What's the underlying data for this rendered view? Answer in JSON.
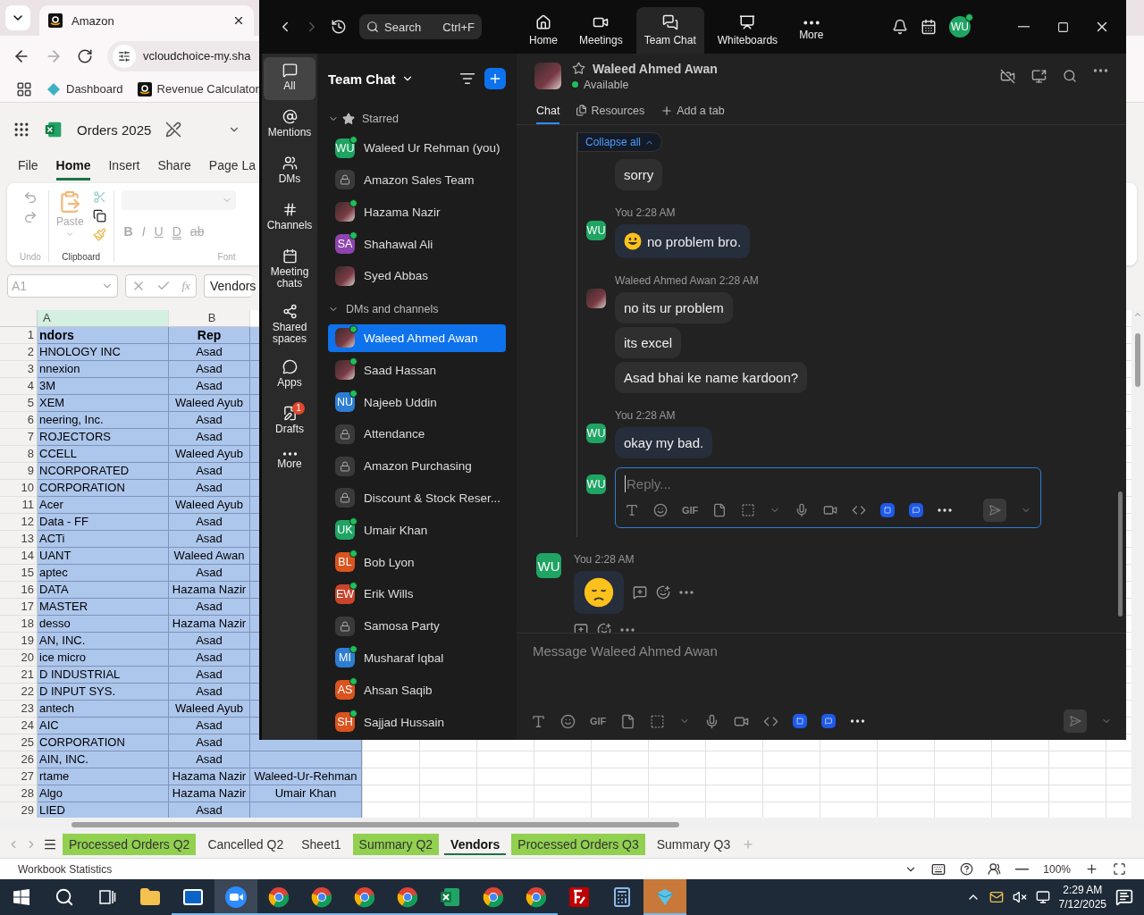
{
  "browser": {
    "tab": {
      "title": "Amazon"
    },
    "url": "vcloudchoice-my.sha",
    "bookmarks": [
      {
        "label": "Dashboard",
        "kind": "diamond"
      },
      {
        "label": "Revenue Calculator",
        "kind": "amazon"
      }
    ]
  },
  "excel": {
    "title": "Orders 2025",
    "ribbon_tabs": [
      {
        "label": "File",
        "selected": false
      },
      {
        "label": "Home",
        "selected": true
      },
      {
        "label": "Insert",
        "selected": false
      },
      {
        "label": "Share",
        "selected": false
      },
      {
        "label": "Page La",
        "selected": false
      }
    ],
    "ribbon": {
      "undo_label": "Undo",
      "paste_label": "Paste",
      "clipboard_label": "Clipboard",
      "font_label": "Font",
      "font_buttons": [
        "B",
        "I",
        "U",
        "D",
        "ab"
      ]
    },
    "name_box": "A1",
    "function_label": "fx",
    "formula": "Vendors",
    "columns": [
      "A",
      "B"
    ],
    "rows": [
      {
        "number": "1",
        "kind": "header",
        "selected": true,
        "a": "ndors",
        "b": "Rep"
      },
      {
        "number": "2",
        "kind": "data",
        "selected": true,
        "a": "HNOLOGY INC",
        "b": "Asad"
      },
      {
        "number": "3",
        "kind": "data",
        "selected": true,
        "a": "nnexion",
        "b": "Asad"
      },
      {
        "number": "4",
        "kind": "data",
        "selected": true,
        "a": "3M",
        "b": "Asad"
      },
      {
        "number": "5",
        "kind": "data",
        "selected": true,
        "a": "XEM",
        "b": "Waleed Ayub"
      },
      {
        "number": "6",
        "kind": "data",
        "selected": true,
        "a": "neering, Inc.",
        "b": "Asad"
      },
      {
        "number": "7",
        "kind": "data",
        "selected": true,
        "a": "ROJECTORS",
        "b": "Asad"
      },
      {
        "number": "8",
        "kind": "data",
        "selected": true,
        "a": "CCELL",
        "b": "Waleed Ayub"
      },
      {
        "number": "9",
        "kind": "data",
        "selected": true,
        "a": "NCORPORATED",
        "b": "Asad"
      },
      {
        "number": "10",
        "kind": "data",
        "selected": true,
        "a": "CORPORATION",
        "b": "Asad"
      },
      {
        "number": "11",
        "kind": "data",
        "selected": true,
        "a": "Acer",
        "b": "Waleed Ayub"
      },
      {
        "number": "12",
        "kind": "data",
        "selected": true,
        "a": "Data - FF",
        "b": "Asad"
      },
      {
        "number": "13",
        "kind": "data",
        "selected": true,
        "a": "ACTi",
        "b": "Asad"
      },
      {
        "number": "14",
        "kind": "data",
        "selected": true,
        "a": "UANT",
        "b": "Waleed Awan"
      },
      {
        "number": "15",
        "kind": "data",
        "selected": true,
        "a": "aptec",
        "b": "Asad"
      },
      {
        "number": "16",
        "kind": "data",
        "selected": true,
        "a": "DATA",
        "b": "Hazama Nazir"
      },
      {
        "number": "17",
        "kind": "data",
        "selected": true,
        "a": "MASTER",
        "b": "Asad"
      },
      {
        "number": "18",
        "kind": "data",
        "selected": true,
        "a": "desso",
        "b": "Hazama Nazir"
      },
      {
        "number": "19",
        "kind": "data",
        "selected": true,
        "a": "AN, INC.",
        "b": "Asad"
      },
      {
        "number": "20",
        "kind": "data",
        "selected": true,
        "a": "ice micro",
        "b": "Asad"
      },
      {
        "number": "21",
        "kind": "data",
        "selected": true,
        "a": "D INDUSTRIAL",
        "b": "Asad"
      },
      {
        "number": "22",
        "kind": "data",
        "selected": true,
        "a": "D INPUT SYS.",
        "b": "Asad"
      },
      {
        "number": "23",
        "kind": "data",
        "selected": true,
        "a": "antech",
        "b": "Waleed Ayub"
      },
      {
        "number": "24",
        "kind": "data",
        "selected": true,
        "a": "AIC",
        "b": "Asad"
      },
      {
        "number": "25",
        "kind": "data",
        "selected": true,
        "a": "CORPORATION",
        "b": "Asad"
      },
      {
        "number": "26",
        "kind": "data",
        "selected": true,
        "a": "AIN, INC.",
        "b": "Asad"
      },
      {
        "number": "27",
        "kind": "data",
        "selected": true,
        "a": "rtame",
        "b": "Hazama Nazir",
        "c": "Waleed-Ur-Rehman"
      },
      {
        "number": "28",
        "kind": "data",
        "selected": true,
        "a": "Algo",
        "b": "Hazama Nazir",
        "c": "Umair Khan"
      },
      {
        "number": "29",
        "kind": "data",
        "selected": true,
        "a": "LIED",
        "b": "Asad"
      }
    ],
    "sheet_tabs": [
      {
        "label": "Processed Orders Q2",
        "selected": false,
        "color": "#92d050"
      },
      {
        "label": "Cancelled Q2",
        "selected": false
      },
      {
        "label": "Sheet1",
        "selected": false
      },
      {
        "label": "Summary Q2",
        "selected": false,
        "color": "#92d050"
      },
      {
        "label": "Vendors",
        "selected": true
      },
      {
        "label": "Processed Orders Q3",
        "selected": false,
        "color": "#92d050"
      },
      {
        "label": "Summary Q3",
        "selected": false
      }
    ],
    "status": "Workbook Statistics",
    "zoom": "100%"
  },
  "zoom_app": {
    "search": {
      "placeholder": "Search",
      "shortcut": "Ctrl+F"
    },
    "nav": [
      {
        "label": "Home",
        "kind": "home",
        "selected": false
      },
      {
        "label": "Meetings",
        "kind": "video",
        "selected": false
      },
      {
        "label": "Team Chat",
        "kind": "chat",
        "selected": true
      },
      {
        "label": "Whiteboards",
        "kind": "board",
        "selected": false
      },
      {
        "label": "More",
        "kind": "more",
        "selected": false
      }
    ],
    "me": {
      "initials": "WU",
      "color": "#1fa463"
    },
    "rail": [
      {
        "label": "All",
        "kind": "chat",
        "selected": true
      },
      {
        "label": "Mentions",
        "kind": "mention",
        "selected": false
      },
      {
        "label": "DMs",
        "kind": "people",
        "selected": false
      },
      {
        "label": "Channels",
        "kind": "hash",
        "selected": false
      },
      {
        "label": "Meeting chats",
        "kind": "calendar",
        "selected": false
      },
      {
        "label": "Shared spaces",
        "kind": "share",
        "selected": false
      },
      {
        "label": "Apps",
        "kind": "bubble",
        "selected": false
      },
      {
        "label": "Drafts",
        "kind": "draft",
        "selected": false,
        "badge": "1"
      },
      {
        "label": "More",
        "kind": "more",
        "selected": false
      }
    ],
    "chat_list": {
      "title": "Team Chat",
      "sections": [
        {
          "title": "Starred",
          "kind": "starred",
          "items": [
            {
              "name": "Waleed Ur Rehman (you)",
              "avatar": {
                "kind": "initials",
                "initials": "WU",
                "color": "#1fa463"
              },
              "online": true,
              "selected": false
            },
            {
              "name": "Amazon Sales Team",
              "avatar": {
                "kind": "lock"
              },
              "online": false,
              "selected": false
            },
            {
              "name": "Hazama Nazir",
              "avatar": {
                "kind": "photo"
              },
              "online": true,
              "selected": false
            },
            {
              "name": "Shahawal Ali",
              "avatar": {
                "kind": "initials",
                "initials": "SA",
                "color": "#8e44ad"
              },
              "online": true,
              "selected": false
            },
            {
              "name": "Syed Abbas",
              "avatar": {
                "kind": "photo"
              },
              "online": false,
              "selected": false
            }
          ]
        },
        {
          "title": "DMs and channels",
          "kind": "plain",
          "items": [
            {
              "name": "Waleed Ahmed Awan",
              "avatar": {
                "kind": "photo"
              },
              "online": true,
              "selected": true
            },
            {
              "name": "Saad Hassan",
              "avatar": {
                "kind": "photo"
              },
              "online": true,
              "selected": false
            },
            {
              "name": "Najeeb Uddin",
              "avatar": {
                "kind": "initials",
                "initials": "NU",
                "color": "#2d7dd2"
              },
              "online": true,
              "selected": false
            },
            {
              "name": "Attendance",
              "avatar": {
                "kind": "lock"
              },
              "online": false,
              "selected": false
            },
            {
              "name": "Amazon Purchasing",
              "avatar": {
                "kind": "lock"
              },
              "online": false,
              "selected": false
            },
            {
              "name": "Discount & Stock Reser...",
              "avatar": {
                "kind": "lock"
              },
              "online": false,
              "selected": false
            },
            {
              "name": "Umair Khan",
              "avatar": {
                "kind": "initials",
                "initials": "UK",
                "color": "#1fa463"
              },
              "online": true,
              "selected": false
            },
            {
              "name": "Bob Lyon",
              "avatar": {
                "kind": "initials",
                "initials": "BL",
                "color": "#d9541e"
              },
              "online": true,
              "selected": false
            },
            {
              "name": "Erik Wills",
              "avatar": {
                "kind": "initials",
                "initials": "EW",
                "color": "#c8452c"
              },
              "online": true,
              "selected": false
            },
            {
              "name": "Samosa Party",
              "avatar": {
                "kind": "lock"
              },
              "online": false,
              "selected": false
            },
            {
              "name": "Musharaf Iqbal",
              "avatar": {
                "kind": "initials",
                "initials": "MI",
                "color": "#2d7dd2"
              },
              "online": true,
              "selected": false
            },
            {
              "name": "Ahsan Saqib",
              "avatar": {
                "kind": "initials",
                "initials": "AS",
                "color": "#d9541e"
              },
              "online": true,
              "selected": false
            },
            {
              "name": "Sajjad Hussain",
              "avatar": {
                "kind": "initials",
                "initials": "SH",
                "color": "#d9541e"
              },
              "online": true,
              "selected": false
            }
          ]
        }
      ]
    },
    "conversation": {
      "name": "Waleed Ahmed Awan",
      "status": "Available",
      "tabs": [
        {
          "label": "Chat",
          "kind": "chat",
          "selected": true
        },
        {
          "label": "Resources",
          "kind": "files",
          "selected": false
        },
        {
          "label": "Add a tab",
          "kind": "add",
          "selected": false
        }
      ],
      "thread": {
        "collapse_label": "Collapse all",
        "groups": [
          {
            "kind": "continuation",
            "mine": false,
            "bubbles": [
              {
                "kind": "text",
                "text": "sorry"
              }
            ]
          },
          {
            "kind": "message",
            "mine": true,
            "avatar": {
              "kind": "initials",
              "initials": "WU",
              "color": "#1fa463"
            },
            "header": "You 2:28 AM",
            "bubbles": [
              {
                "kind": "smile-text",
                "text": "no problem bro."
              }
            ]
          },
          {
            "kind": "message",
            "mine": false,
            "avatar": {
              "kind": "photo"
            },
            "header": "Waleed Ahmed Awan 2:28 AM",
            "bubbles": [
              {
                "kind": "text",
                "text": "no its ur problem"
              },
              {
                "kind": "text",
                "text": "its excel"
              },
              {
                "kind": "text",
                "text": "Asad bhai ke name kardoon?"
              }
            ]
          },
          {
            "kind": "message",
            "mine": true,
            "avatar": {
              "kind": "initials",
              "initials": "WU",
              "color": "#1fa463"
            },
            "header": "You 2:28 AM",
            "bubbles": [
              {
                "kind": "text",
                "text": "okay my bad."
              }
            ]
          }
        ],
        "reply": {
          "avatar": {
            "kind": "initials",
            "initials": "WU",
            "color": "#1fa463"
          },
          "placeholder": "Reply...",
          "gif_label": "GIF"
        }
      },
      "last_message": {
        "avatar": {
          "kind": "initials",
          "initials": "WU",
          "color": "#1fa463"
        },
        "header": "You 2:28 AM",
        "bubbles": [
          {
            "kind": "frown"
          }
        ]
      },
      "compose": {
        "placeholder": "Message Waleed Ahmed Awan",
        "gif_label": "GIF"
      }
    }
  },
  "taskbar": {
    "apps": [
      {
        "kind": "start",
        "running": false,
        "selected": false,
        "attention": false
      },
      {
        "kind": "search",
        "running": false,
        "selected": false,
        "attention": false
      },
      {
        "kind": "taskview",
        "running": false,
        "selected": false,
        "attention": false
      },
      {
        "kind": "folder",
        "running": false,
        "selected": false,
        "attention": false
      },
      {
        "kind": "outlook",
        "running": true,
        "selected": false,
        "attention": false
      },
      {
        "kind": "zoom",
        "running": true,
        "selected": true,
        "attention": false
      },
      {
        "kind": "chrome",
        "running": true,
        "selected": false,
        "attention": false
      },
      {
        "kind": "chrome",
        "running": true,
        "selected": false,
        "attention": false
      },
      {
        "kind": "chrome",
        "running": true,
        "selected": false,
        "attention": false
      },
      {
        "kind": "chrome",
        "running": true,
        "selected": false,
        "attention": false
      },
      {
        "kind": "excel",
        "running": true,
        "selected": false,
        "attention": false
      },
      {
        "kind": "chrome",
        "running": true,
        "selected": false,
        "attention": false
      },
      {
        "kind": "chrome",
        "running": true,
        "selected": false,
        "attention": false
      },
      {
        "kind": "filezilla",
        "running": false,
        "selected": false,
        "attention": false
      },
      {
        "kind": "calculator",
        "running": false,
        "selected": false,
        "attention": false
      },
      {
        "kind": "app",
        "running": true,
        "selected": false,
        "attention": true
      }
    ],
    "time": "2:29 AM",
    "date": "7/12/2025"
  }
}
